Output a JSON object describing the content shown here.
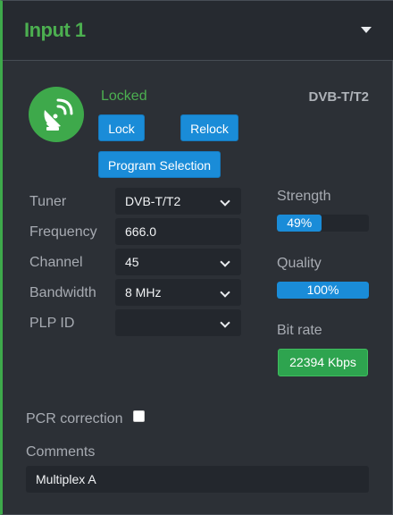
{
  "header": {
    "title": "Input 1",
    "collapse_icon": "caret-down-icon"
  },
  "status": {
    "icon": "satellite-dish-icon",
    "state": "Locked",
    "standard": "DVB-T/T2",
    "state_color": "#4caf50"
  },
  "buttons": {
    "lock": "Lock",
    "relock": "Relock",
    "program_selection": "Program Selection"
  },
  "settings": {
    "tuner": {
      "label": "Tuner",
      "value": "DVB-T/T2"
    },
    "frequency": {
      "label": "Frequency",
      "value": "666.0"
    },
    "channel": {
      "label": "Channel",
      "value": "45"
    },
    "bandwidth": {
      "label": "Bandwidth",
      "value": "8 MHz"
    },
    "plp_id": {
      "label": "PLP ID",
      "value": ""
    }
  },
  "metrics": {
    "strength": {
      "label": "Strength",
      "text": "49%",
      "percent": 49
    },
    "quality": {
      "label": "Quality",
      "text": "100%",
      "percent": 100
    },
    "bitrate": {
      "label": "Bit rate",
      "value": "22394 Kbps"
    }
  },
  "pcr": {
    "label": "PCR correction",
    "checked": false
  },
  "comments": {
    "label": "Comments",
    "value": "Multiplex A"
  },
  "colors": {
    "accent_green": "#3ea94b",
    "button_blue": "#1a8cd8",
    "background": "#2c3036"
  }
}
